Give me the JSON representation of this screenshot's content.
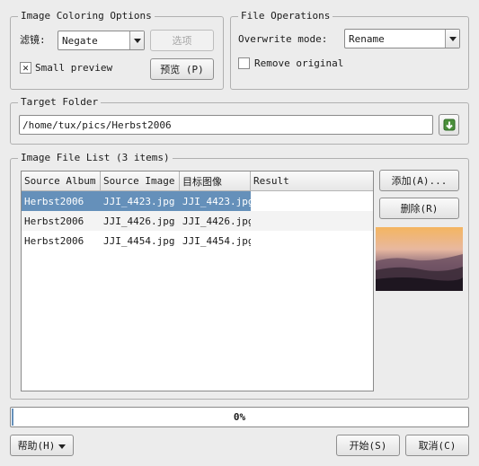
{
  "image_coloring": {
    "title": "Image Coloring Options",
    "filter_label": "滤镜:",
    "filter_value": "Negate",
    "options_button": "选项",
    "small_preview_label": "Small preview",
    "small_preview_checked": true,
    "preview_button": "预览 (P)"
  },
  "file_operations": {
    "title": "File Operations",
    "overwrite_label": "Overwrite mode:",
    "overwrite_value": "Rename",
    "remove_original_label": "Remove original",
    "remove_original_checked": false
  },
  "target_folder": {
    "title": "Target Folder",
    "path": "/home/tux/pics/Herbst2006"
  },
  "file_list": {
    "title": "Image File List (3 items)",
    "columns": [
      "Source Album",
      "Source Image",
      "目标图像",
      "Result"
    ],
    "rows": [
      [
        "Herbst2006",
        "JJI_4423.jpg",
        "JJI_4423.jpg",
        ""
      ],
      [
        "Herbst2006",
        "JJI_4426.jpg",
        "JJI_4426.jpg",
        ""
      ],
      [
        "Herbst2006",
        "JJI_4454.jpg",
        "JJI_4454.jpg",
        ""
      ]
    ],
    "selected_row": 0,
    "add_button": "添加(A)...",
    "remove_button": "删除(R)"
  },
  "progress": {
    "value": 0,
    "text": "0%"
  },
  "footer": {
    "help_button": "帮助(H)",
    "start_button": "开始(S)",
    "cancel_button": "取消(C)"
  },
  "colors": {
    "selection": "#6590ba",
    "background": "#ececec"
  }
}
